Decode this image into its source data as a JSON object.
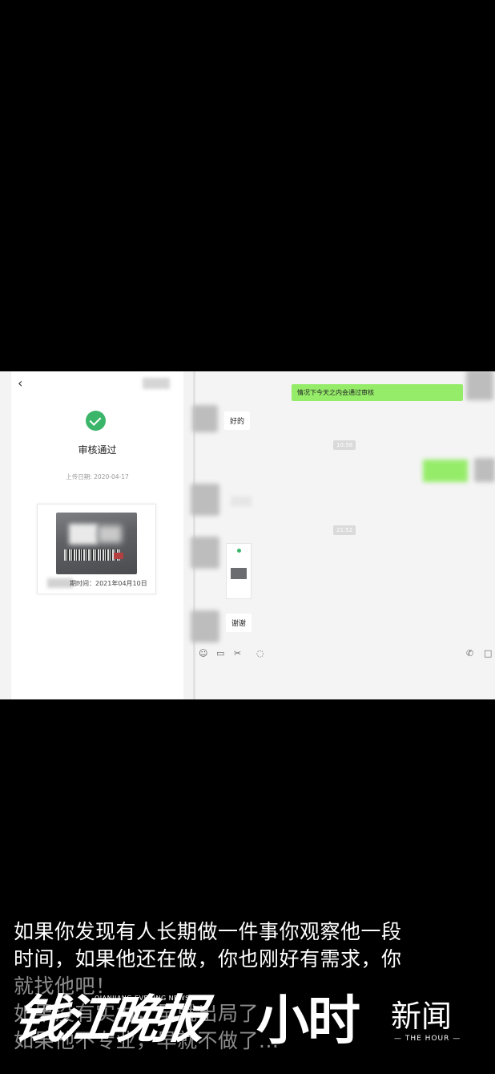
{
  "review_page": {
    "back_icon": "chevron-left-icon",
    "status_title": "审核通过",
    "upload_date": "上传日期: 2020-04-17",
    "expiry_text": "期时间：2021年04月10日",
    "status_color": "#3bb56a"
  },
  "chat": {
    "messages": [
      {
        "side": "out",
        "text": "情况下今天之内会通过审核"
      },
      {
        "side": "in",
        "text": "好的"
      },
      {
        "side": "time",
        "text": "10:58"
      },
      {
        "side": "time",
        "text": "21:52"
      },
      {
        "side": "in",
        "text": "谢谢"
      }
    ],
    "bubble_out_color": "#95ec69",
    "toolbar_icons": [
      "emoji-icon",
      "folder-icon",
      "scissors-icon",
      "chat-icon",
      "phone-icon",
      "video-icon"
    ]
  },
  "caption": {
    "lines": [
      "如果你发现有人长期做一件事你观察他一段",
      "时间，如果他还在做，你也刚好有需求，你",
      "就找他吧！",
      "如果没有实力，早就出局了",
      "如果他不专业，早就不做了..."
    ]
  },
  "watermark": {
    "brand_cn": "钱江晚报",
    "brand_en": "QIANJIANG EVENING NEWS",
    "hour": "小时",
    "news": "新闻",
    "the_hour": "— THE HOUR —"
  }
}
